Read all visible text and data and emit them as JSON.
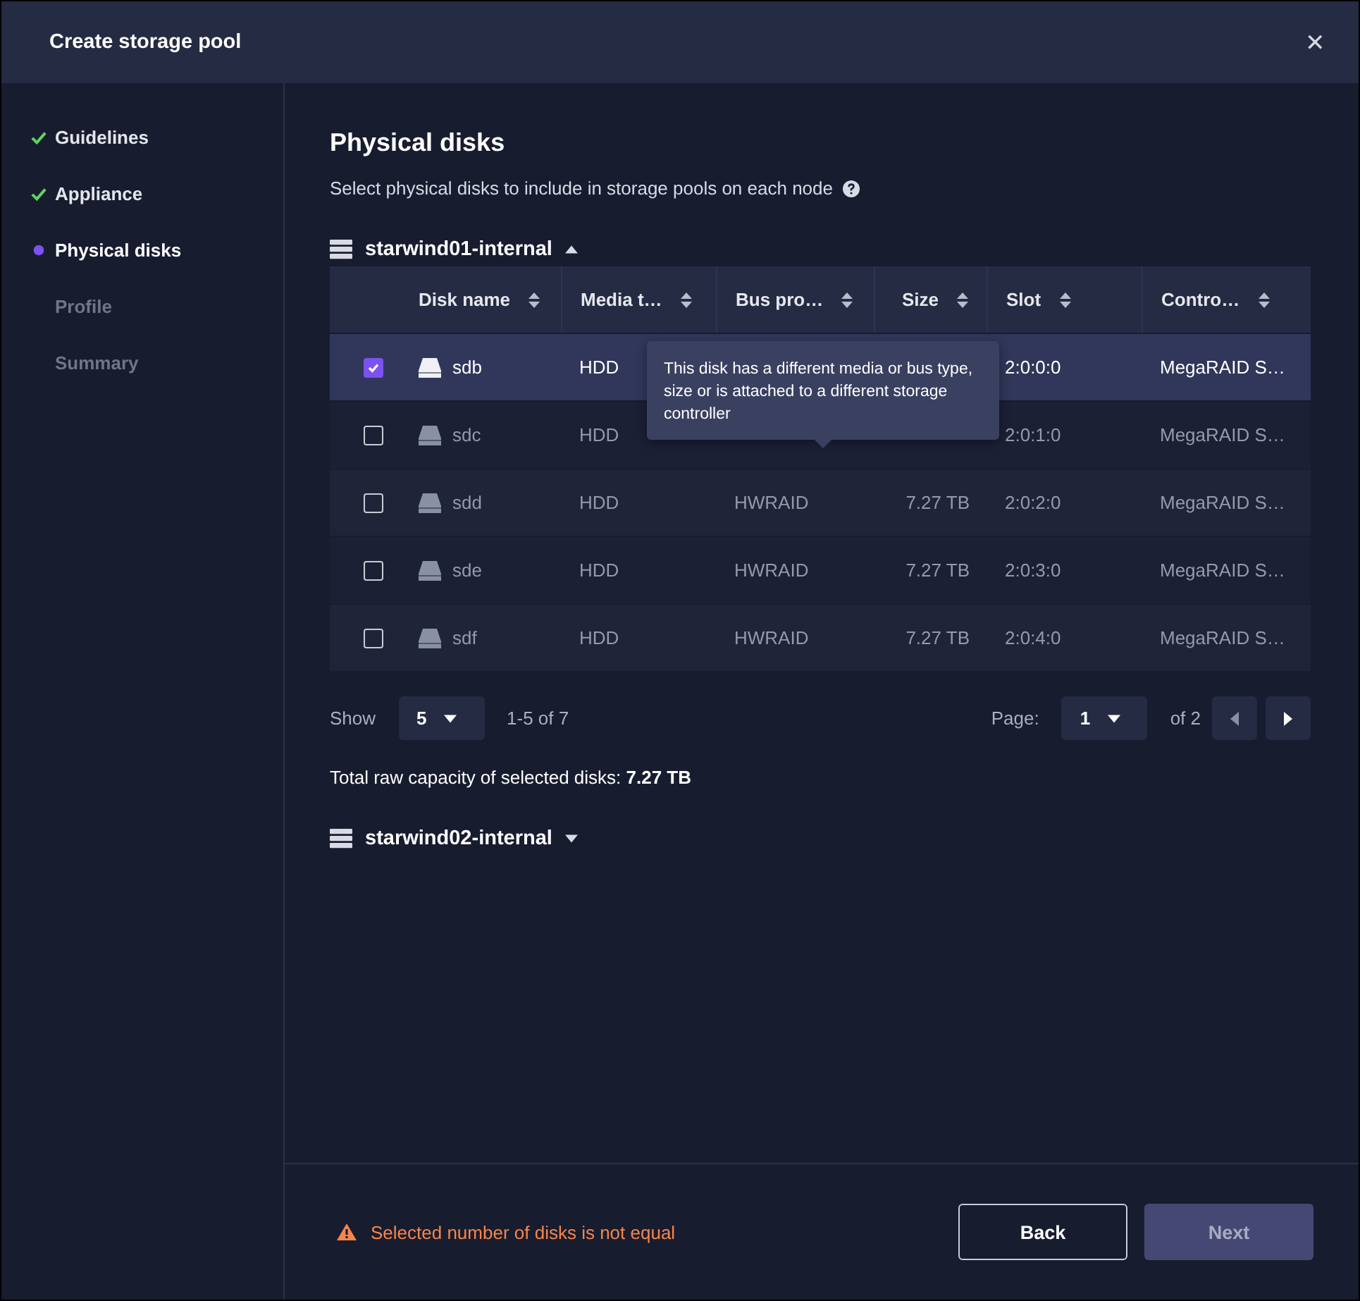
{
  "window": {
    "title": "Create storage pool",
    "close": "✕"
  },
  "steps": [
    {
      "label": "Guidelines",
      "completed": true,
      "selected": false
    },
    {
      "label": "Appliance",
      "completed": true,
      "selected": false
    },
    {
      "label": "Physical disks",
      "completed": false,
      "selected": true
    },
    {
      "label": "Profile",
      "completed": false,
      "selected": false
    },
    {
      "label": "Summary",
      "completed": false,
      "selected": false
    }
  ],
  "page": {
    "title": "Physical disks",
    "description": "Select physical disks to include in storage pools on each node"
  },
  "nodes": [
    {
      "name": "starwind01-internal",
      "expanded": true,
      "table": {
        "columns": [
          "Disk name",
          "Media t…",
          "Bus pro…",
          "Size",
          "Slot",
          "Contro…"
        ],
        "rows": [
          {
            "selected": true,
            "disk": "sdb",
            "media": "HDD",
            "slot": "2:0:0:0",
            "controller": "MegaRAID S…"
          },
          {
            "selected": false,
            "disk": "sdc",
            "media": "HDD",
            "slot": "2:0:1:0",
            "controller": "MegaRAID S…"
          },
          {
            "selected": false,
            "disk": "sdd",
            "media": "HDD",
            "bus": "HWRAID",
            "size": "7.27 TB",
            "slot": "2:0:2:0",
            "controller": "MegaRAID S…"
          },
          {
            "selected": false,
            "disk": "sde",
            "media": "HDD",
            "bus": "HWRAID",
            "size": "7.27 TB",
            "slot": "2:0:3:0",
            "controller": "MegaRAID S…"
          },
          {
            "selected": false,
            "disk": "sdf",
            "media": "HDD",
            "bus": "HWRAID",
            "size": "7.27 TB",
            "slot": "2:0:4:0",
            "controller": "MegaRAID S…"
          }
        ],
        "tooltip": "This disk has a different media or bus type, size or is attached to a different storage controller"
      },
      "pagination": {
        "show_label": "Show",
        "page_size": "5",
        "range": "1-5 of 7",
        "page_label": "Page:",
        "page": "1",
        "of": "of 2"
      },
      "total": "Total raw capacity of selected disks: **7.27 TB**"
    },
    {
      "name": "starwind02-internal",
      "expanded": false
    }
  ],
  "footer": {
    "warning": "Selected number of disks is not equal",
    "buttons": [
      {
        "label": "Back",
        "kind": "secondary",
        "disabled": false
      },
      {
        "label": "Next",
        "kind": "primary",
        "disabled": true
      }
    ]
  }
}
